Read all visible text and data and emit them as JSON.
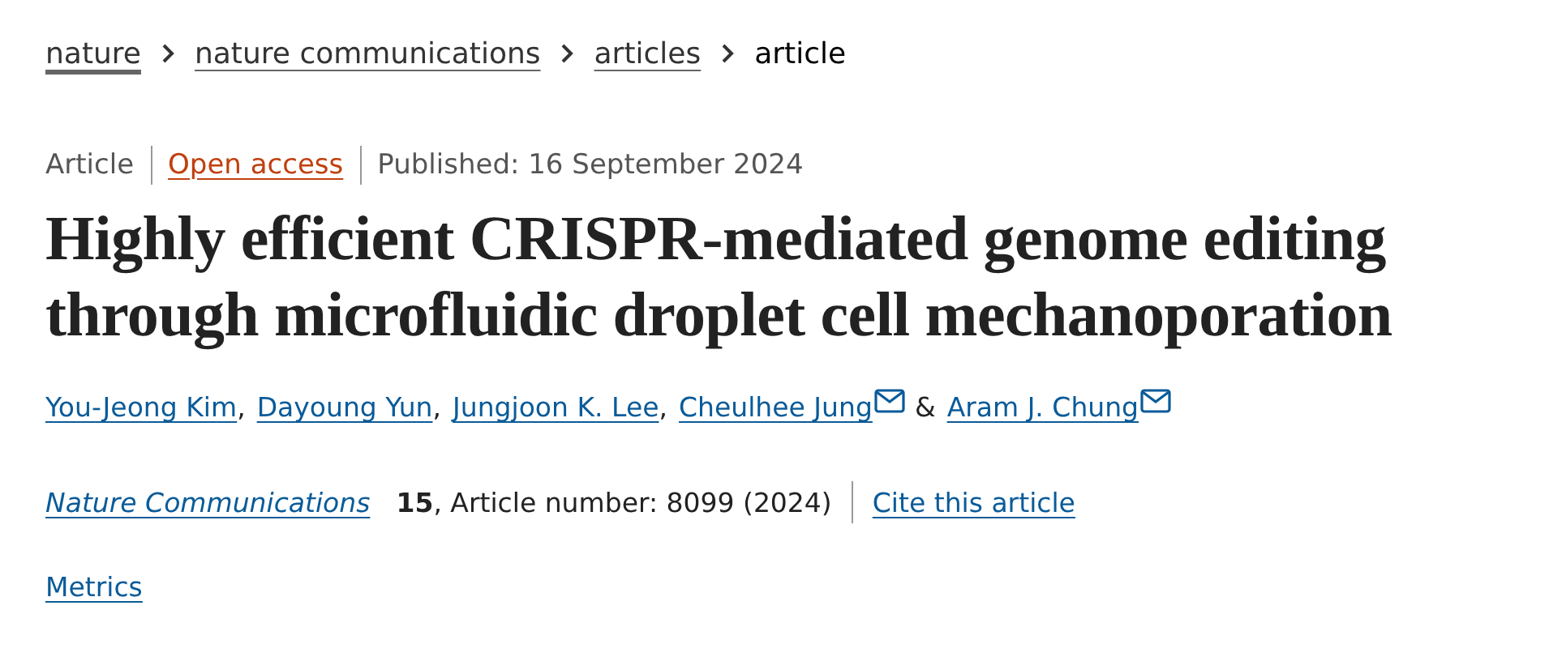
{
  "breadcrumb": [
    {
      "label": "nature",
      "kind": "home"
    },
    {
      "label": "nature communications",
      "kind": "link"
    },
    {
      "label": "articles",
      "kind": "link"
    },
    {
      "label": "article",
      "kind": "current"
    }
  ],
  "meta": {
    "type": "Article",
    "access": "Open access",
    "published": "Published: 16 September 2024"
  },
  "title": "Highly efficient CRISPR-mediated genome editing through microfluidic droplet cell mechanoporation",
  "authors": [
    {
      "name": "You-Jeong Kim",
      "email": false,
      "sep": ","
    },
    {
      "name": "Dayoung Yun",
      "email": false,
      "sep": ","
    },
    {
      "name": "Jungjoon K. Lee",
      "email": false,
      "sep": ","
    },
    {
      "name": "Cheulhee Jung",
      "email": true,
      "sep": "&"
    },
    {
      "name": "Aram J. Chung",
      "email": true
    }
  ],
  "citation": {
    "journal": "Nature Communications",
    "details": "**15**, Article number: 8099 (2024)",
    "cite_link": "Cite this article"
  },
  "metrics_link": "Metrics"
}
